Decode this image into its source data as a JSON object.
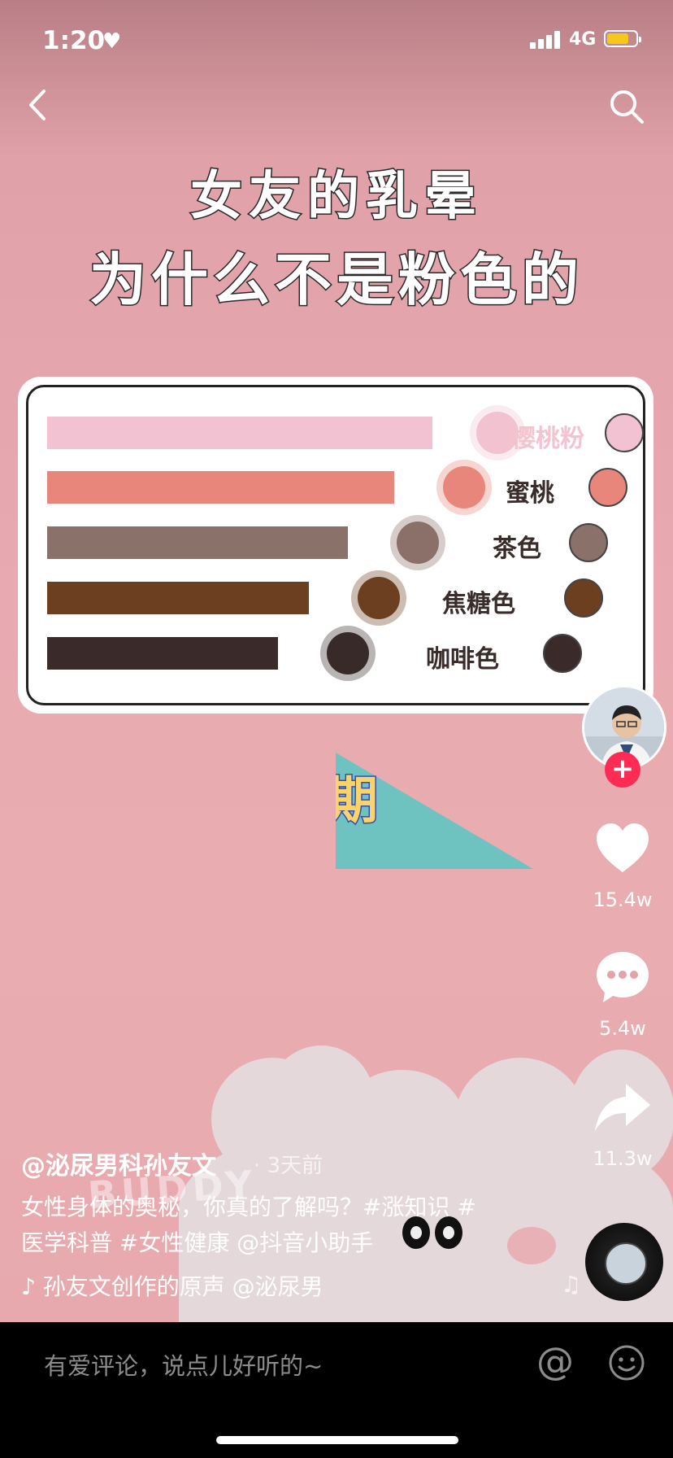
{
  "status_bar": {
    "time": "1:20",
    "network": "4G"
  },
  "video": {
    "title_line1": "女友的乳晕",
    "title_line2": "为什么不是粉色的",
    "sticker_text": "期",
    "colors": [
      {
        "label": "樱桃粉",
        "bar_color": "#f3c2d2",
        "fill_fraction": 1.0
      },
      {
        "label": "蜜桃",
        "bar_color": "#e8867c",
        "fill_fraction": 0.9
      },
      {
        "label": "茶色",
        "bar_color": "#8a7169",
        "fill_fraction": 0.78
      },
      {
        "label": "焦糖色",
        "bar_color": "#6c3f21",
        "fill_fraction": 0.68
      },
      {
        "label": "咖啡色",
        "bar_color": "#3a2a2a",
        "fill_fraction": 0.6
      }
    ],
    "background_text": "BUDDY"
  },
  "actions": {
    "likes": "15.4w",
    "comments": "5.4w",
    "shares": "11.3w"
  },
  "post": {
    "author": "@泌尿男科孙友文",
    "time_ago": "· 3天前",
    "description_line1": "女性身体的奥秘，你真的了解吗？#涨知识 #",
    "description_line2": "医学科普 #女性健康 @抖音小助手",
    "music": "♪ 孙友文创作的原声    @泌尿男"
  },
  "comment_bar": {
    "placeholder": "有爱评论，说点儿好听的~",
    "at_symbol": "@"
  }
}
